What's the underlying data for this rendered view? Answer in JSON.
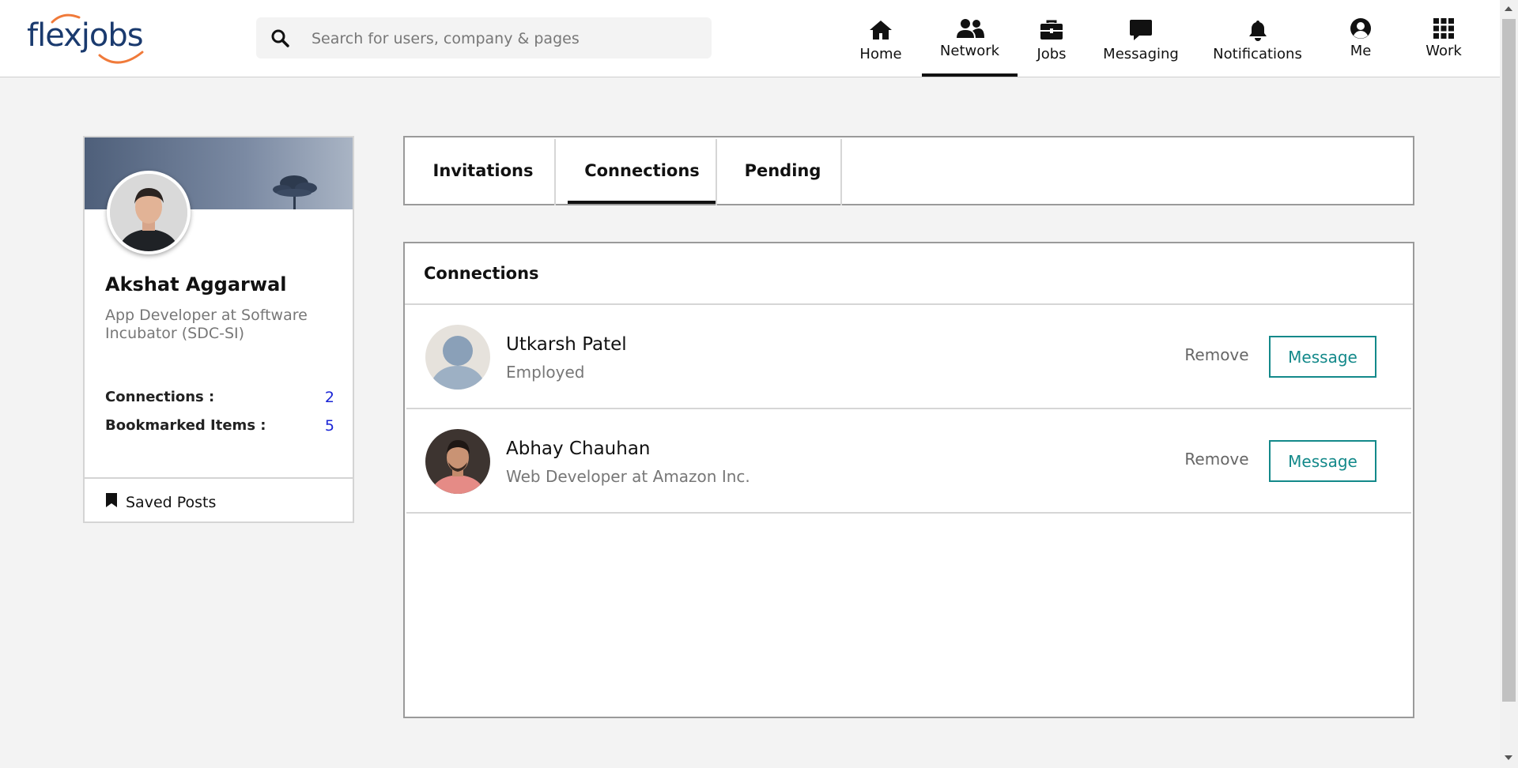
{
  "header": {
    "logo_text": "flexjobs",
    "search": {
      "placeholder": "Search for users, company & pages",
      "value": ""
    },
    "nav": [
      {
        "label": "Home",
        "icon": "home-icon"
      },
      {
        "label": "Network",
        "icon": "network-icon",
        "active": true
      },
      {
        "label": "Jobs",
        "icon": "briefcase-icon"
      },
      {
        "label": "Messaging",
        "icon": "message-icon"
      },
      {
        "label": "Notifications",
        "icon": "bell-icon"
      },
      {
        "label": "Me",
        "icon": "user-circle-icon"
      },
      {
        "label": "Work",
        "icon": "grid-icon"
      }
    ]
  },
  "profile": {
    "name": "Akshat Aggarwal",
    "title": "App Developer at Software Incubator (SDC-SI)",
    "stats": [
      {
        "label": "Connections :",
        "value": "2"
      },
      {
        "label": "Bookmarked Items :",
        "value": "5"
      }
    ],
    "saved_posts_label": "Saved Posts"
  },
  "tabs": [
    {
      "label": "Invitations"
    },
    {
      "label": "Connections",
      "active": true
    },
    {
      "label": "Pending"
    }
  ],
  "connections": {
    "title": "Connections",
    "items": [
      {
        "name": "Utkarsh Patel",
        "subtitle": "Employed",
        "remove_label": "Remove",
        "message_label": "Message"
      },
      {
        "name": "Abhay Chauhan",
        "subtitle": "Web Developer at Amazon Inc.",
        "remove_label": "Remove",
        "message_label": "Message"
      }
    ]
  },
  "colors": {
    "accent_teal": "#13898a",
    "stat_value_blue": "#1a25d6",
    "logo_blue": "#1a3a6e",
    "logo_orange": "#f07a3a"
  }
}
